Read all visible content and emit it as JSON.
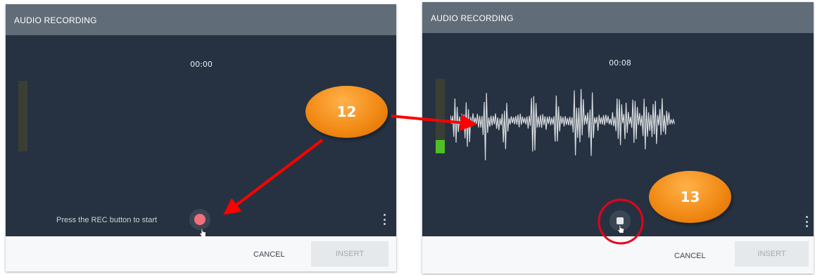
{
  "left_dialog": {
    "title": "AUDIO RECORDING",
    "timer": "00:00",
    "meter_level": 0,
    "hint": "Press the REC button to start",
    "rec_button_color": "#f26e7c",
    "cancel_label": "CANCEL",
    "insert_label": "INSERT"
  },
  "right_dialog": {
    "title": "AUDIO RECORDING",
    "timer": "00:08",
    "meter_level": 0.18,
    "cancel_label": "CANCEL",
    "insert_label": "INSERT"
  },
  "callouts": [
    {
      "label": "12",
      "color": "#f28b16"
    },
    {
      "label": "13",
      "color": "#f28b16"
    }
  ],
  "colors": {
    "dialog_bg": "#263241",
    "header_bg": "#606d78",
    "arrow": "#ff0000",
    "meter_level": "#4ec026"
  },
  "icons": {
    "more": "more-vertical-icon",
    "record": "record-icon",
    "stop": "stop-icon",
    "cursor": "hand-cursor-icon"
  }
}
